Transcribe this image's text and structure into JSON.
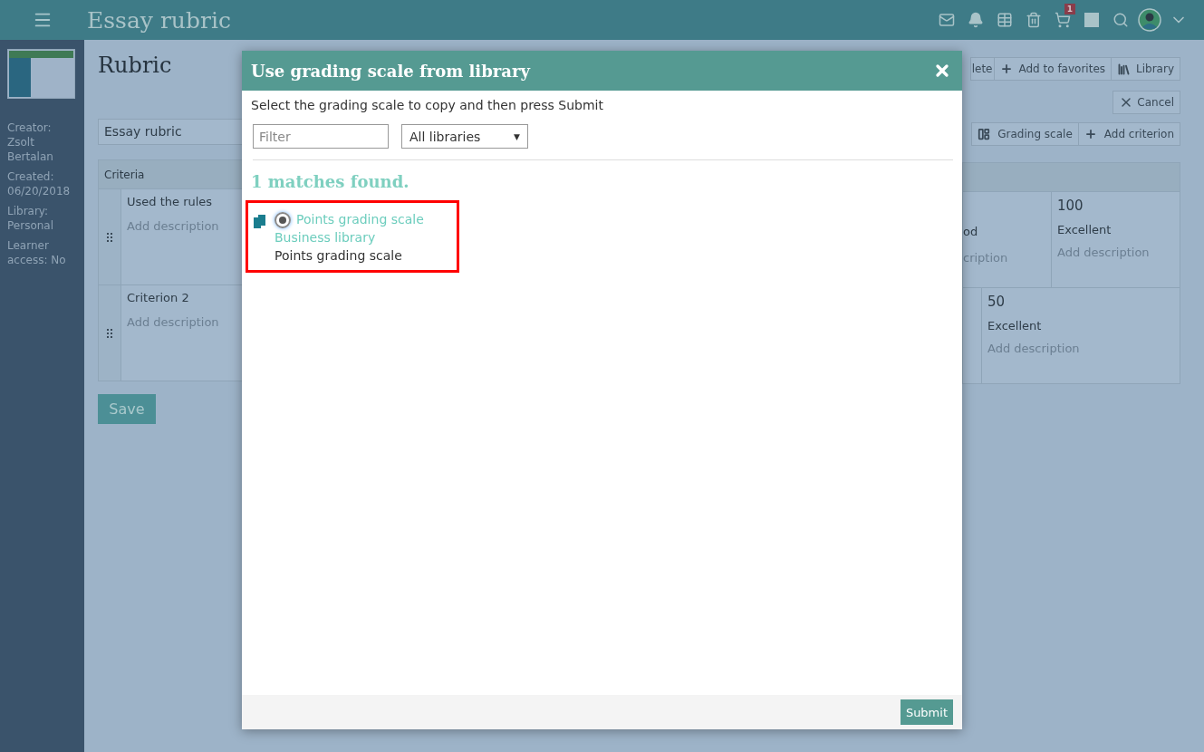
{
  "top_bar": {
    "title": "Essay rubric",
    "cart_badge": "1"
  },
  "sidebar": {
    "details": [
      "Creator: Zsolt Bertalan",
      "Created: 06/20/2018",
      "Library: Personal",
      "Learner access: No"
    ]
  },
  "page": {
    "heading": "Rubric",
    "name_value": "Essay rubric",
    "toolbar": [
      {
        "label": "lete",
        "kind": "plain"
      },
      {
        "label": "Add to favorites",
        "kind": "add"
      },
      {
        "label": "Library",
        "kind": "library"
      }
    ],
    "cancel": "Cancel",
    "actions": [
      {
        "label": "Grading scale",
        "kind": "scale"
      },
      {
        "label": "Add criterion",
        "kind": "add"
      }
    ],
    "table": {
      "header": "Criteria",
      "rows": [
        {
          "name": "Used the rules",
          "description": "Add description",
          "levels": [
            {
              "kind": "cut",
              "title": "od",
              "description": "cription"
            },
            {
              "kind": "full",
              "points": "100",
              "title": "Excellent",
              "description": "Add description"
            }
          ]
        },
        {
          "name": "Criterion 2",
          "description": "Add description",
          "levels": [
            {
              "kind": "cut"
            },
            {
              "kind": "full",
              "points": "50",
              "title": "Excellent",
              "description": "Add description"
            }
          ]
        }
      ]
    },
    "save": "Save"
  },
  "dialog": {
    "title": "Use grading scale from library",
    "instruction": "Select the grading scale to copy and then press Submit",
    "filter_placeholder": "Filter",
    "library_select": "All libraries",
    "select_arrow": "▼",
    "result_count": "1 matches found.",
    "results": [
      {
        "name": "Points grading scale",
        "library": "Business library",
        "description": "Points grading scale",
        "selected": true,
        "highlighted": true
      }
    ],
    "submit": "Submit"
  }
}
